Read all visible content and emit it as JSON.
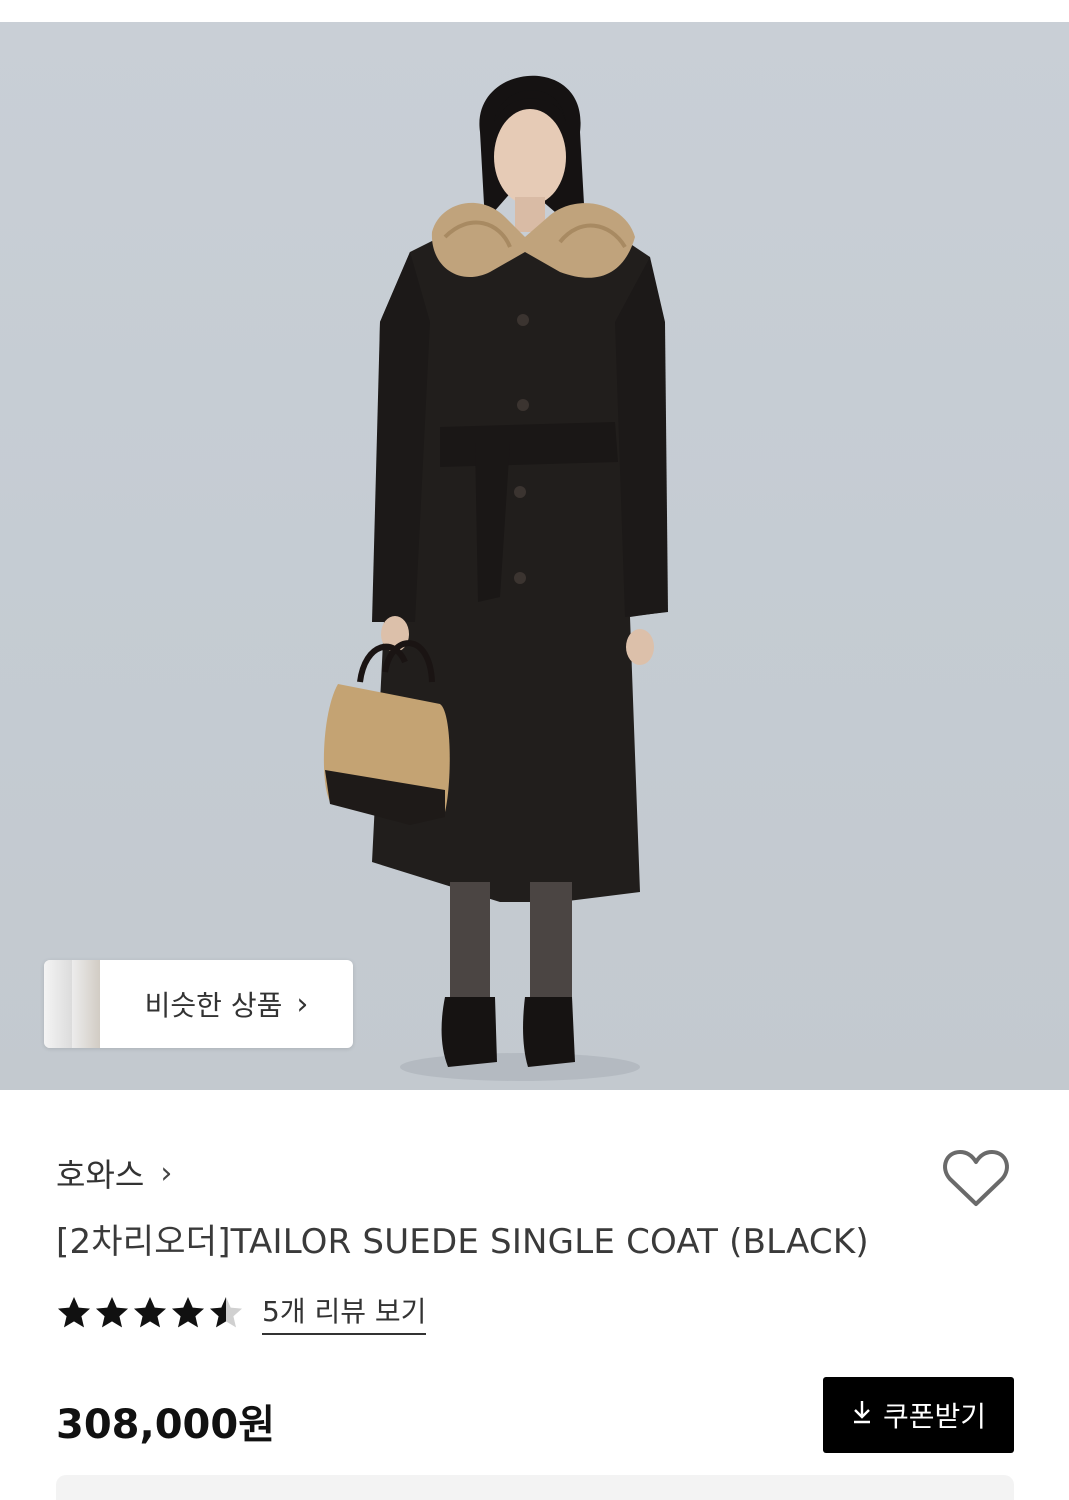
{
  "similar_products": {
    "label": "비슷한 상품",
    "chevron": "›"
  },
  "brand": {
    "name": "호와스",
    "chevron": "›"
  },
  "product": {
    "title": "[2차리오더]TAILOR SUEDE SINGLE COAT (BLACK)",
    "price": "308,000원"
  },
  "rating": {
    "value": 4.5,
    "max": 5,
    "review_link": "5개 리뷰 보기"
  },
  "coupon": {
    "label": "쿠폰받기",
    "icon": "download-icon"
  },
  "wishlist": {
    "icon": "heart-icon"
  },
  "colors": {
    "coupon_bg": "#000000",
    "text": "#333333",
    "photo_bg": "#c7cdd4"
  }
}
